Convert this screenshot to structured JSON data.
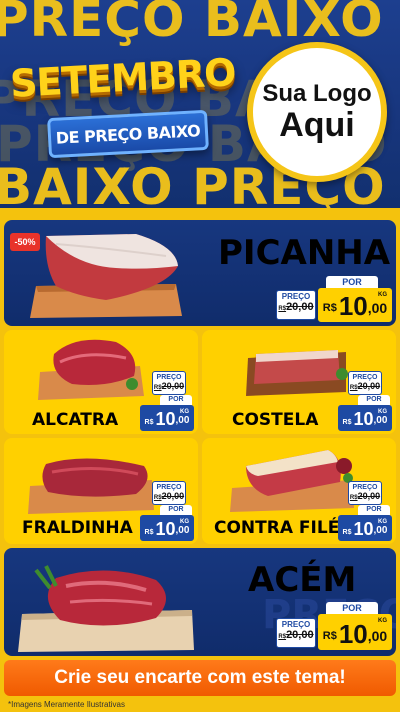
{
  "background_words": {
    "top": "PREÇO BAIXO",
    "mid1": "PREÇO BAIXO",
    "mid2": "PREÇO BAIXO",
    "bottom": "BAIXO PREÇO"
  },
  "title": {
    "main": "SETEMBRO",
    "sub": "DE PREÇO BAIXO"
  },
  "logo": {
    "line1": "Sua Logo",
    "line2": "Aqui"
  },
  "discount_badge": "-50%",
  "products": {
    "picanha": {
      "name": "PICANHA",
      "preco_label": "PREÇO",
      "old_currency": "R$",
      "old_price": "20,00",
      "por_label": "POR",
      "currency": "R$",
      "price_int": "10",
      "price_dec": ",00",
      "unit": "KG"
    },
    "alcatra": {
      "name": "ALCATRA",
      "preco_label": "PREÇO",
      "old_currency": "R$",
      "old_price": "20,00",
      "por_label": "POR",
      "currency": "R$",
      "price_int": "10",
      "price_dec": ",00",
      "unit": "KG"
    },
    "costela": {
      "name": "COSTELA",
      "preco_label": "PREÇO",
      "old_currency": "R$",
      "old_price": "20,00",
      "por_label": "POR",
      "currency": "R$",
      "price_int": "10",
      "price_dec": ",00",
      "unit": "KG"
    },
    "fraldinha": {
      "name": "FRALDINHA",
      "preco_label": "PREÇO",
      "old_currency": "R$",
      "old_price": "20,00",
      "por_label": "POR",
      "currency": "R$",
      "price_int": "10",
      "price_dec": ",00",
      "unit": "KG"
    },
    "contra_file": {
      "name": "CONTRA FILÉ",
      "preco_label": "PREÇO",
      "old_currency": "R$",
      "old_price": "20,00",
      "por_label": "POR",
      "currency": "R$",
      "price_int": "10",
      "price_dec": ",00",
      "unit": "KG"
    },
    "acem": {
      "name": "ACÉM",
      "preco_label": "PREÇO",
      "old_currency": "R$",
      "old_price": "20,00",
      "por_label": "POR",
      "currency": "R$",
      "price_int": "10",
      "price_dec": ",00",
      "unit": "KG"
    }
  },
  "cta": "Crie seu encarte com este tema!",
  "disclaimer": "*Imagens Meramente Ilustrativas",
  "watermark": "PREÇO",
  "colors": {
    "header_blue": "#17357c",
    "accent_yellow": "#ffd000",
    "cta_orange": "#f05a00",
    "discount_red": "#e8332a",
    "price_blue": "#1e4aa3"
  }
}
